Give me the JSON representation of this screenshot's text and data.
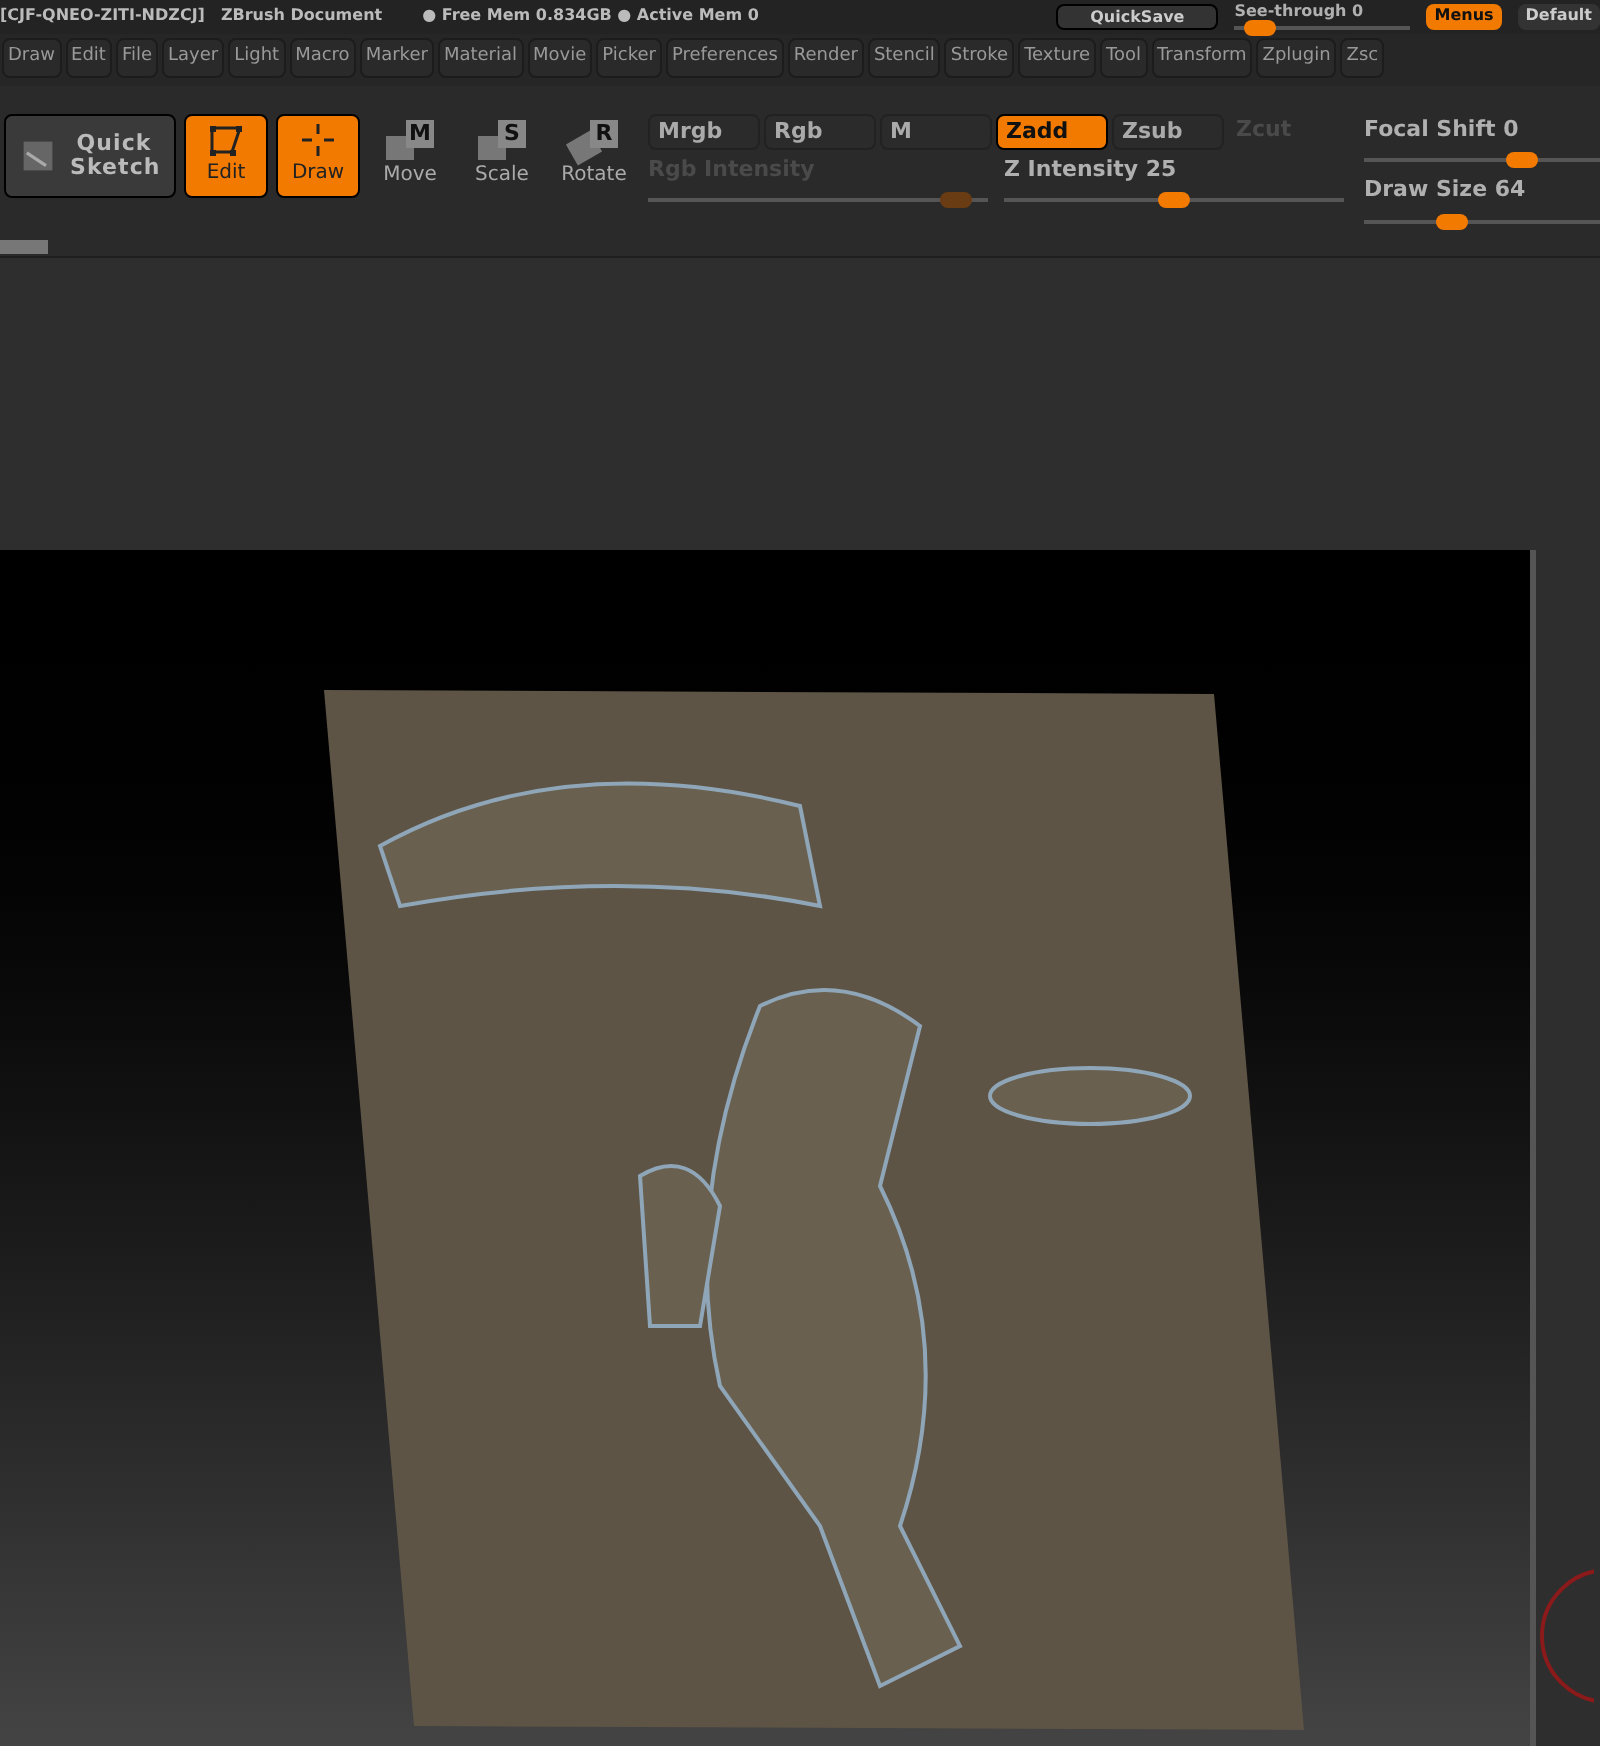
{
  "title_bar": {
    "texts": [
      "[CJF-QNEO-ZITI-NDZCJ]",
      "ZBrush Document",
      "● Free Mem 0.834GB ● Active Mem 0"
    ],
    "quicksave": "QuickSave",
    "see_through": {
      "label": "See-through  0",
      "level": 0.06
    },
    "menus_button": {
      "label": "Menus",
      "selected": true
    },
    "default_button": "Default"
  },
  "progress": {
    "level": 0.03
  },
  "menu_bar": [
    "Draw",
    "Edit",
    "File",
    "Layer",
    "Light",
    "Macro",
    "Marker",
    "Material",
    "Movie",
    "Picker",
    "Preferences",
    "Render",
    "Stencil",
    "Stroke",
    "Texture",
    "Tool",
    "Transform",
    "Zplugin",
    "Zsc"
  ],
  "tools": [
    {
      "kind": "sketch",
      "label": "Quick Sketch",
      "selected": false
    },
    {
      "kind": "edit",
      "label": "Edit",
      "selected": true
    },
    {
      "kind": "draw",
      "label": "Draw",
      "selected": true
    },
    {
      "kind": "move",
      "label": "Move",
      "key": "M",
      "selected": false
    },
    {
      "kind": "scale",
      "label": "Scale",
      "key": "S",
      "selected": false
    },
    {
      "kind": "rotate",
      "label": "Rotate",
      "key": "R",
      "selected": false
    }
  ],
  "modes_row1": [
    {
      "label": "Mrgb",
      "selected": false,
      "disabled": false
    },
    {
      "label": "Rgb",
      "selected": false,
      "disabled": false
    },
    {
      "label": "M",
      "selected": false,
      "disabled": false
    }
  ],
  "modes_row2": [
    {
      "label": "Zadd",
      "selected": true,
      "disabled": false
    },
    {
      "label": "Zsub",
      "selected": false,
      "disabled": false
    },
    {
      "label": "Zcut",
      "selected": false,
      "disabled": true
    }
  ],
  "sliders": [
    {
      "label": "Rgb  Intensity",
      "level": 0.95,
      "disabled": true
    },
    {
      "label": "Z  Intensity 25",
      "level": 0.5,
      "disabled": false
    }
  ],
  "right_sliders": [
    {
      "label": "Focal  Shift 0",
      "level": 0.7
    },
    {
      "label": "Draw  Size 64",
      "level": 0.35
    }
  ]
}
